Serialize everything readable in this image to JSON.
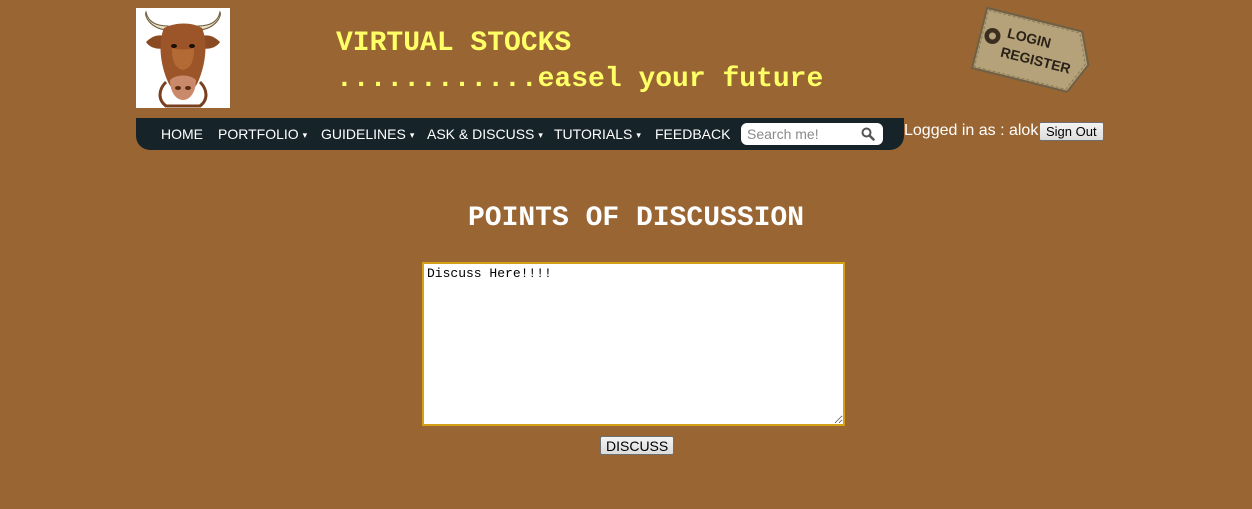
{
  "header": {
    "title": "VIRTUAL STOCKS",
    "tagline": "............easel your future",
    "tag_line1": "LOGIN",
    "tag_line2": "REGISTER"
  },
  "nav": {
    "items": [
      {
        "label": "HOME",
        "has_dropdown": false
      },
      {
        "label": "PORTFOLIO",
        "has_dropdown": true
      },
      {
        "label": "GUIDELINES",
        "has_dropdown": true
      },
      {
        "label": "ASK & DISCUSS",
        "has_dropdown": true
      },
      {
        "label": "TUTORIALS",
        "has_dropdown": true
      },
      {
        "label": "FEEDBACK",
        "has_dropdown": false
      }
    ],
    "search_placeholder": "Search me!",
    "search_icon": "search-icon"
  },
  "session": {
    "logged_in_text": "Logged in as : alok",
    "signout_label": "Sign Out"
  },
  "main": {
    "title": "POINTS OF DISCUSSION",
    "textarea_value": "Discuss Here!!!!",
    "submit_label": "DISCUSS"
  },
  "colors": {
    "background": "#996633",
    "brand_text": "#ffff66",
    "navbar": "#16242a",
    "textarea_border": "#d4a017"
  }
}
